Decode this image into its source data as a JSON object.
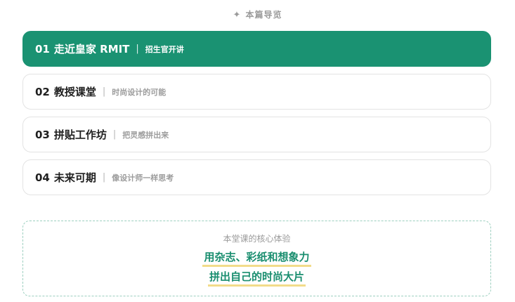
{
  "nav": {
    "header_icon": "sparkle-icon",
    "header_label": "本篇导览",
    "items": [
      {
        "num": "01",
        "title": "走近皇家 RMIT",
        "sep": "|",
        "subtitle": "招生官开讲",
        "active": true
      },
      {
        "num": "02",
        "title": "教授课堂",
        "sep": "|",
        "subtitle": "时尚设计的可能",
        "active": false
      },
      {
        "num": "03",
        "title": "拼贴工作坊",
        "sep": "|",
        "subtitle": "把灵感拼出来",
        "active": false
      },
      {
        "num": "04",
        "title": "未来可期",
        "sep": "|",
        "subtitle": "像设计师一样思考",
        "active": false
      }
    ]
  },
  "core": {
    "label": "本堂课的核心体验",
    "line1": "用杂志、彩纸和想象力",
    "line2": "拼出自己的时尚大片"
  },
  "colors": {
    "accent": "#1a9272",
    "highlight": "#f2dc8a",
    "border": "#e3e3e3"
  }
}
